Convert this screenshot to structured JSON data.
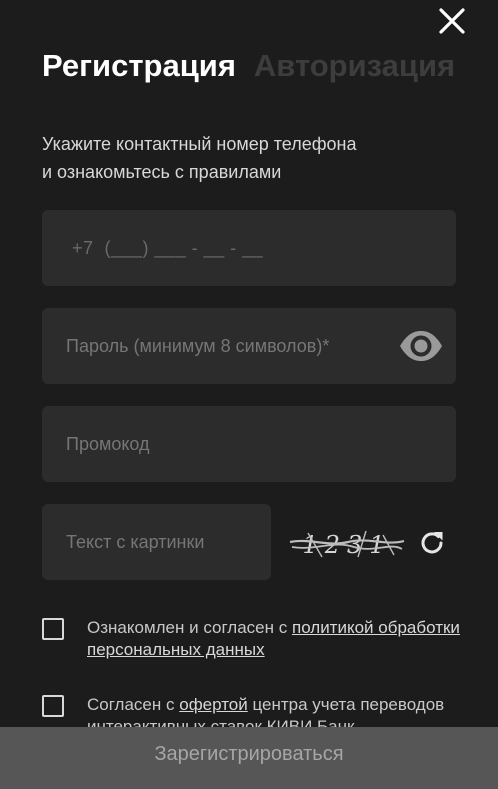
{
  "colors": {
    "background": "#1c1c1c",
    "field": "#2c2c2c",
    "button": "#565656",
    "tab_inactive": "#3d3d3d"
  },
  "close": {
    "icon": "close-icon"
  },
  "tabs": [
    {
      "label": "Регистрация",
      "active": true
    },
    {
      "label": "Авторизация",
      "active": false
    }
  ],
  "instruction": {
    "line1": "Укажите контактный номер телефона",
    "line2": "и ознакомьтесь с правилами"
  },
  "form": {
    "phone": {
      "placeholder": "+7  (___) ___ - __ - __"
    },
    "password": {
      "placeholder": "Пароль (минимум 8 символов)*",
      "toggle_icon": "eye-icon"
    },
    "promo": {
      "placeholder": "Промокод"
    },
    "captcha": {
      "placeholder": "Текст с картинки",
      "image_text": "1231",
      "refresh_icon": "refresh-icon"
    }
  },
  "agreements": [
    {
      "text_before": "Ознакомлен и согласен с ",
      "link": "политикой обработки персональных данных",
      "text_after": ""
    },
    {
      "text_before": "Согласен с ",
      "link": "офертой",
      "text_after": " центра учета переводов интерактивных ставок КИВИ Банк"
    }
  ],
  "submit": {
    "label": "Зарегистрироваться"
  }
}
